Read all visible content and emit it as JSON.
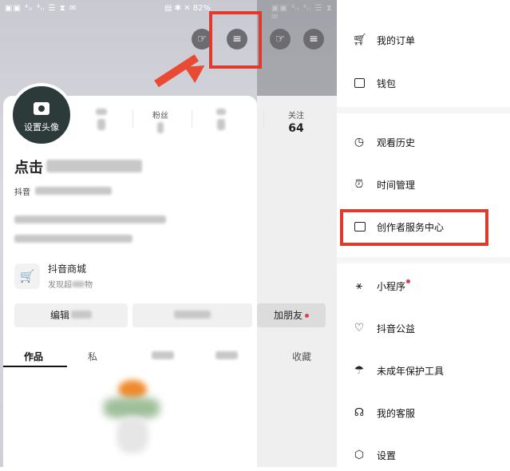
{
  "status": {
    "left": "▣▣ ⁴ᵢᵢ ⁴ᵢᵢ ☰ ⧗ ✉",
    "middle": "▤ ✱ ✕ 82%",
    "right": "▣▣ ⁴ᵢᵢ ⁴ᵢᵢ ☰ ⧗ ✉"
  },
  "profile": {
    "avatar_label": "设置头像",
    "stats": [
      {
        "label": "粉丝",
        "value": ""
      },
      {
        "label": "关注",
        "value": "64"
      }
    ],
    "name_prefix": "点击",
    "douyin_prefix": "抖音",
    "shop_title": "抖音商城",
    "shop_sub_prefix": "发现超",
    "shop_sub_suffix": "物",
    "edit_button": "编辑",
    "add_friend_button": "加朋友",
    "tabs": [
      {
        "label": "作品"
      },
      {
        "label": "私"
      },
      {
        "label": "收藏"
      }
    ]
  },
  "drawer": {
    "items": [
      {
        "label": "我的订单",
        "icon": "cart-icon"
      },
      {
        "label": "钱包",
        "icon": "wallet-icon"
      },
      {
        "label": "观看历史",
        "icon": "clock-icon"
      },
      {
        "label": "时间管理",
        "icon": "alarm-icon"
      },
      {
        "label": "创作者服务中心",
        "icon": "chart-icon"
      },
      {
        "label": "小程序",
        "icon": "asterisk-icon"
      },
      {
        "label": "抖音公益",
        "icon": "heart-icon"
      },
      {
        "label": "未成年保护工具",
        "icon": "umbrella-icon"
      },
      {
        "label": "我的客服",
        "icon": "headset-icon"
      },
      {
        "label": "设置",
        "icon": "settings-icon"
      }
    ]
  },
  "colors": {
    "highlight": "#e03a2e",
    "notification_dot": "#e53a4f"
  }
}
